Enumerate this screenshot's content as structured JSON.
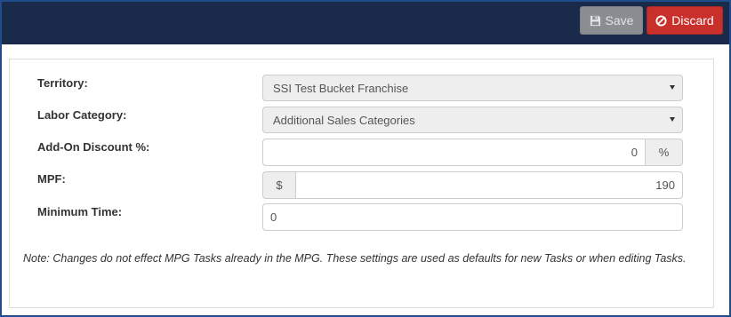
{
  "toolbar": {
    "save_label": "Save",
    "discard_label": "Discard"
  },
  "form": {
    "territory": {
      "label": "Territory:",
      "value": "SSI Test Bucket Franchise"
    },
    "labor_category": {
      "label": "Labor Category:",
      "value": "Additional Sales Categories"
    },
    "add_on_discount": {
      "label": "Add-On Discount %:",
      "value": "0",
      "addon": "%"
    },
    "mpf": {
      "label": "MPF:",
      "addon": "$",
      "value": "190"
    },
    "minimum_time": {
      "label": "Minimum Time:",
      "value": "0"
    }
  },
  "note": "Note: Changes do not effect MPG Tasks already in the MPG. These settings are used as defaults for new Tasks or when editing Tasks.",
  "colors": {
    "header_bg": "#1a2a4a",
    "save_button": "#8a8e93",
    "discard_button": "#c9302c",
    "frame_border": "#1f4d8c"
  }
}
